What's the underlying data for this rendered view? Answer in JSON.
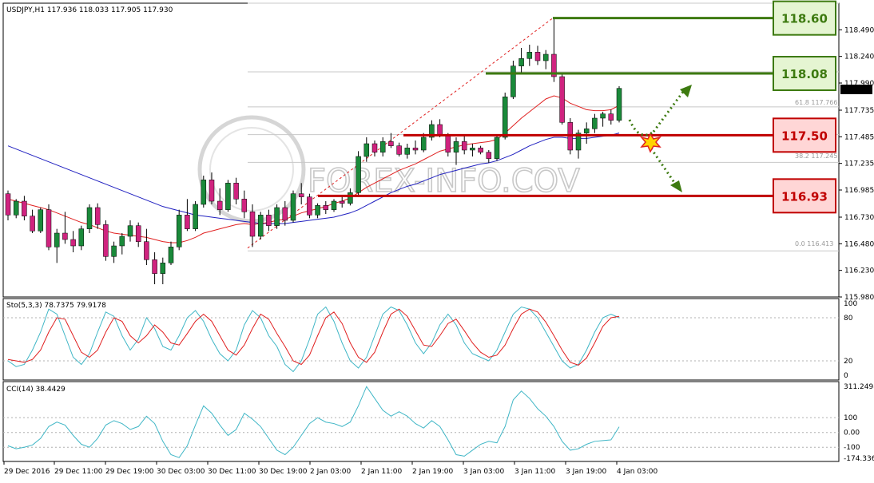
{
  "header": {
    "symbol": "USDJPY,H1",
    "ohlc": "117.936 118.033 117.905 117.930"
  },
  "watermark": "FOREX-INFO.COV",
  "price_axis": {
    "ticks": [
      "118.490",
      "118.240",
      "117.990",
      "117.735",
      "117.485",
      "117.235",
      "116.985",
      "116.730",
      "116.480",
      "116.230",
      "115.980"
    ],
    "current_price": "117.930"
  },
  "fib": {
    "l618": "61.8 117.766",
    "l382": "38.2 117.245",
    "l0": "0.0 116.413"
  },
  "levels": [
    {
      "price": 118.6,
      "label": "118.60",
      "color": "#3d7a10",
      "fill": "#e5f5d2"
    },
    {
      "price": 118.08,
      "label": "118.08",
      "color": "#3d7a10",
      "fill": "#e5f5d2"
    },
    {
      "price": 117.5,
      "label": "117.50",
      "color": "#c00000",
      "fill": "#ffd6d6"
    },
    {
      "price": 116.93,
      "label": "116.93",
      "color": "#c00000",
      "fill": "#ffd6d6"
    }
  ],
  "stoch": {
    "label": "Sto(5,3,3) 78.7375 79.9178",
    "ticks": [
      "100",
      "80",
      "20",
      "0"
    ]
  },
  "cci": {
    "label": "CCI(14) 38.4429",
    "ticks": [
      "311.2498",
      "100",
      "0.00",
      "-100",
      "-174.3363"
    ]
  },
  "time_axis": [
    "29 Dec 2016",
    "29 Dec 11:00",
    "29 Dec 19:00",
    "30 Dec 03:00",
    "30 Dec 11:00",
    "30 Dec 19:00",
    "2 Jan 03:00",
    "2 Jan 11:00",
    "2 Jan 19:00",
    "3 Jan 03:00",
    "3 Jan 11:00",
    "3 Jan 19:00",
    "4 Jan 03:00"
  ],
  "colors": {
    "bull": "#1a8a3a",
    "bear": "#d0237f",
    "ma_fast": "#e02020",
    "ma_slow": "#2020c0",
    "stoch_main": "#3fb6c6",
    "stoch_signal": "#e02020",
    "cci": "#3fb6c6",
    "arrow": "#3d7a10"
  },
  "chart_data": {
    "type": "candlestick",
    "title": "USDJPY,H1",
    "ylim": [
      115.98,
      118.74
    ],
    "candles": [
      [
        116.95,
        116.98,
        116.7,
        116.75
      ],
      [
        116.75,
        116.9,
        116.72,
        116.88
      ],
      [
        116.88,
        116.93,
        116.7,
        116.74
      ],
      [
        116.74,
        116.8,
        116.58,
        116.6
      ],
      [
        116.6,
        116.82,
        116.58,
        116.8
      ],
      [
        116.8,
        116.85,
        116.42,
        116.45
      ],
      [
        116.45,
        116.62,
        116.3,
        116.58
      ],
      [
        116.58,
        116.78,
        116.48,
        116.52
      ],
      [
        116.52,
        116.6,
        116.4,
        116.46
      ],
      [
        116.46,
        116.65,
        116.42,
        116.62
      ],
      [
        116.62,
        116.85,
        116.58,
        116.82
      ],
      [
        116.82,
        116.86,
        116.62,
        116.66
      ],
      [
        116.66,
        116.7,
        116.32,
        116.36
      ],
      [
        116.36,
        116.5,
        116.3,
        116.46
      ],
      [
        116.46,
        116.58,
        116.38,
        116.55
      ],
      [
        116.55,
        116.7,
        116.5,
        116.65
      ],
      [
        116.65,
        116.68,
        116.45,
        116.5
      ],
      [
        116.5,
        116.62,
        116.28,
        116.33
      ],
      [
        116.33,
        116.4,
        116.1,
        116.2
      ],
      [
        116.2,
        116.35,
        116.1,
        116.3
      ],
      [
        116.3,
        116.5,
        116.28,
        116.45
      ],
      [
        116.45,
        116.8,
        116.42,
        116.75
      ],
      [
        116.75,
        116.9,
        116.6,
        116.62
      ],
      [
        116.62,
        116.88,
        116.6,
        116.85
      ],
      [
        116.85,
        117.12,
        116.82,
        117.08
      ],
      [
        117.08,
        117.15,
        116.85,
        116.88
      ],
      [
        116.88,
        117.0,
        116.75,
        116.8
      ],
      [
        116.8,
        117.08,
        116.78,
        117.05
      ],
      [
        117.05,
        117.1,
        116.85,
        116.9
      ],
      [
        116.9,
        116.98,
        116.72,
        116.78
      ],
      [
        116.78,
        116.85,
        116.45,
        116.55
      ],
      [
        116.55,
        116.78,
        116.52,
        116.75
      ],
      [
        116.75,
        116.8,
        116.6,
        116.65
      ],
      [
        116.65,
        116.85,
        116.62,
        116.82
      ],
      [
        116.82,
        116.88,
        116.65,
        116.7
      ],
      [
        116.7,
        116.98,
        116.68,
        116.95
      ],
      [
        116.95,
        117.05,
        116.85,
        116.92
      ],
      [
        116.92,
        116.95,
        116.72,
        116.75
      ],
      [
        116.75,
        116.86,
        116.72,
        116.84
      ],
      [
        116.84,
        116.88,
        116.76,
        116.8
      ],
      [
        116.8,
        116.9,
        116.78,
        116.88
      ],
      [
        116.88,
        116.92,
        116.82,
        116.86
      ],
      [
        116.86,
        117.0,
        116.84,
        116.96
      ],
      [
        116.96,
        117.35,
        116.94,
        117.3
      ],
      [
        117.3,
        117.48,
        117.25,
        117.42
      ],
      [
        117.42,
        117.45,
        117.3,
        117.34
      ],
      [
        117.34,
        117.48,
        117.3,
        117.44
      ],
      [
        117.44,
        117.52,
        117.38,
        117.4
      ],
      [
        117.4,
        117.43,
        117.3,
        117.32
      ],
      [
        117.32,
        117.42,
        117.28,
        117.38
      ],
      [
        117.38,
        117.45,
        117.32,
        117.36
      ],
      [
        117.36,
        117.52,
        117.34,
        117.48
      ],
      [
        117.48,
        117.64,
        117.45,
        117.6
      ],
      [
        117.6,
        117.65,
        117.48,
        117.5
      ],
      [
        117.5,
        117.52,
        117.3,
        117.34
      ],
      [
        117.34,
        117.48,
        117.22,
        117.44
      ],
      [
        117.44,
        117.5,
        117.32,
        117.36
      ],
      [
        117.36,
        117.42,
        117.3,
        117.38
      ],
      [
        117.38,
        117.4,
        117.32,
        117.34
      ],
      [
        117.34,
        117.36,
        117.24,
        117.28
      ],
      [
        117.28,
        117.5,
        117.26,
        117.48
      ],
      [
        117.48,
        117.9,
        117.46,
        117.86
      ],
      [
        117.86,
        118.2,
        117.84,
        118.15
      ],
      [
        118.15,
        118.32,
        118.08,
        118.22
      ],
      [
        118.22,
        118.35,
        118.15,
        118.28
      ],
      [
        118.28,
        118.34,
        118.16,
        118.2
      ],
      [
        118.2,
        118.3,
        118.12,
        118.26
      ],
      [
        118.26,
        118.6,
        118.0,
        118.05
      ],
      [
        118.05,
        118.08,
        117.6,
        117.62
      ],
      [
        117.62,
        117.66,
        117.32,
        117.36
      ],
      [
        117.36,
        117.55,
        117.28,
        117.52
      ],
      [
        117.52,
        117.62,
        117.42,
        117.56
      ],
      [
        117.56,
        117.7,
        117.52,
        117.66
      ],
      [
        117.66,
        117.72,
        117.58,
        117.7
      ],
      [
        117.7,
        117.74,
        117.6,
        117.64
      ],
      [
        117.64,
        117.96,
        117.62,
        117.94
      ]
    ],
    "ma_fast": [
      116.9,
      116.88,
      116.86,
      116.84,
      116.82,
      116.8,
      116.77,
      116.74,
      116.71,
      116.68,
      116.66,
      116.63,
      116.6,
      116.58,
      116.57,
      116.56,
      116.55,
      116.54,
      116.52,
      116.5,
      116.49,
      116.49,
      116.51,
      116.54,
      116.58,
      116.6,
      116.62,
      116.64,
      116.66,
      116.67,
      116.66,
      116.67,
      116.68,
      116.7,
      116.71,
      116.74,
      116.77,
      116.79,
      116.81,
      116.83,
      116.86,
      116.88,
      116.91,
      116.96,
      117.01,
      117.05,
      117.09,
      117.13,
      117.17,
      117.2,
      117.23,
      117.27,
      117.31,
      117.35,
      117.37,
      117.39,
      117.41,
      117.42,
      117.43,
      117.44,
      117.46,
      117.52,
      117.59,
      117.66,
      117.72,
      117.78,
      117.84,
      117.87,
      117.85,
      117.8,
      117.77,
      117.74,
      117.73,
      117.73,
      117.74,
      117.78
    ],
    "ma_slow": [
      117.4,
      117.37,
      117.34,
      117.31,
      117.28,
      117.25,
      117.22,
      117.19,
      117.16,
      117.13,
      117.1,
      117.07,
      117.04,
      117.01,
      116.98,
      116.95,
      116.92,
      116.89,
      116.86,
      116.83,
      116.81,
      116.79,
      116.77,
      116.75,
      116.74,
      116.73,
      116.72,
      116.71,
      116.7,
      116.69,
      116.68,
      116.67,
      116.67,
      116.67,
      116.67,
      116.68,
      116.69,
      116.7,
      116.71,
      116.72,
      116.73,
      116.75,
      116.77,
      116.8,
      116.84,
      116.88,
      116.92,
      116.96,
      116.99,
      117.02,
      117.04,
      117.07,
      117.1,
      117.13,
      117.15,
      117.17,
      117.19,
      117.21,
      117.23,
      117.24,
      117.26,
      117.29,
      117.32,
      117.36,
      117.4,
      117.43,
      117.46,
      117.48,
      117.48,
      117.47,
      117.47,
      117.47,
      117.48,
      117.49,
      117.5,
      117.52
    ],
    "stoch_main": [
      20,
      12,
      15,
      35,
      60,
      92,
      85,
      55,
      25,
      15,
      30,
      60,
      88,
      82,
      55,
      35,
      50,
      80,
      65,
      40,
      35,
      55,
      80,
      90,
      75,
      50,
      30,
      20,
      35,
      70,
      90,
      80,
      55,
      40,
      15,
      5,
      20,
      50,
      85,
      95,
      75,
      45,
      20,
      10,
      25,
      55,
      85,
      95,
      90,
      70,
      45,
      30,
      45,
      70,
      85,
      70,
      45,
      30,
      25,
      20,
      35,
      60,
      85,
      95,
      92,
      80,
      60,
      40,
      20,
      10,
      15,
      35,
      60,
      80,
      85,
      80
    ],
    "stoch_signal": [
      22,
      20,
      18,
      22,
      35,
      60,
      80,
      78,
      55,
      32,
      25,
      35,
      60,
      80,
      75,
      55,
      45,
      55,
      70,
      60,
      45,
      42,
      58,
      75,
      85,
      75,
      55,
      35,
      28,
      42,
      65,
      85,
      78,
      58,
      40,
      20,
      15,
      28,
      55,
      80,
      88,
      72,
      45,
      25,
      18,
      32,
      60,
      85,
      92,
      82,
      62,
      42,
      40,
      55,
      72,
      78,
      62,
      45,
      32,
      25,
      28,
      42,
      65,
      85,
      92,
      88,
      74,
      55,
      35,
      18,
      14,
      24,
      45,
      68,
      80,
      82
    ],
    "cci": [
      -90,
      -110,
      -100,
      -85,
      -40,
      40,
      70,
      50,
      -20,
      -80,
      -100,
      -40,
      50,
      80,
      60,
      20,
      40,
      110,
      60,
      -60,
      -150,
      -170,
      -90,
      50,
      180,
      130,
      50,
      -20,
      20,
      130,
      90,
      40,
      -40,
      -120,
      -150,
      -100,
      -20,
      60,
      100,
      70,
      60,
      40,
      70,
      180,
      310,
      230,
      150,
      110,
      140,
      110,
      60,
      30,
      80,
      40,
      -50,
      -150,
      -160,
      -120,
      -80,
      -60,
      -70,
      40,
      220,
      280,
      230,
      160,
      110,
      40,
      -60,
      -120,
      -110,
      -80,
      -60,
      -55,
      -50,
      38
    ]
  }
}
